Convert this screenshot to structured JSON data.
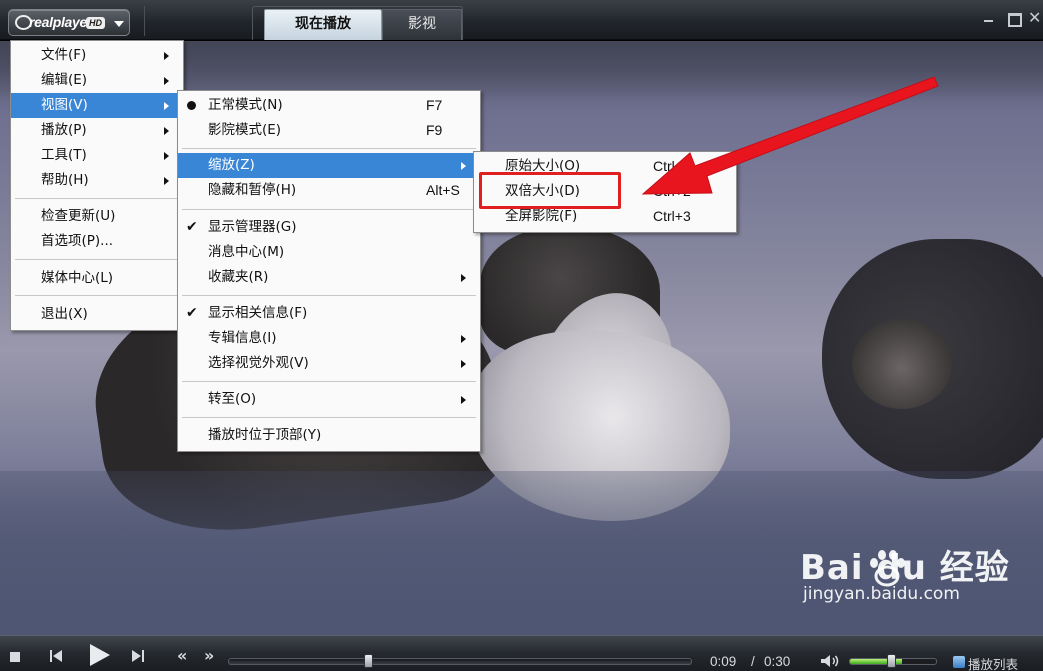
{
  "app": {
    "logo_text": "realplayer",
    "logo_badge": "HD"
  },
  "tabs": [
    {
      "label": "现在播放",
      "active": true
    },
    {
      "label": "影视",
      "active": false
    }
  ],
  "window_controls": {
    "close_glyph": "✕"
  },
  "main_menu": {
    "items": [
      {
        "label": "文件(F)",
        "submenu": true
      },
      {
        "label": "编辑(E)",
        "submenu": true
      },
      {
        "label": "视图(V)",
        "submenu": true,
        "highlighted": true
      },
      {
        "label": "播放(P)",
        "submenu": true
      },
      {
        "label": "工具(T)",
        "submenu": true
      },
      {
        "label": "帮助(H)",
        "submenu": true
      },
      {
        "label": "检查更新(U)"
      },
      {
        "label": "首选项(P)..."
      },
      {
        "label": "媒体中心(L)"
      },
      {
        "label": "退出(X)"
      }
    ]
  },
  "view_menu": {
    "items": [
      {
        "label": "正常模式(N)",
        "shortcut": "F7",
        "mark": "dot"
      },
      {
        "label": "影院模式(E)",
        "shortcut": "F9"
      },
      {
        "label": "缩放(Z)",
        "submenu": true,
        "highlighted": true
      },
      {
        "label": "隐藏和暂停(H)",
        "shortcut": "Alt+S"
      },
      {
        "label": "显示管理器(G)",
        "mark": "check"
      },
      {
        "label": "消息中心(M)"
      },
      {
        "label": "收藏夹(R)",
        "submenu": true
      },
      {
        "label": "显示相关信息(F)",
        "mark": "check"
      },
      {
        "label": "专辑信息(I)",
        "submenu": true
      },
      {
        "label": "选择视觉外观(V)",
        "submenu": true
      },
      {
        "label": "转至(O)",
        "submenu": true
      },
      {
        "label": "播放时位于顶部(Y)"
      }
    ]
  },
  "zoom_menu": {
    "items": [
      {
        "label": "原始大小(O)",
        "shortcut": "Ctrl+1"
      },
      {
        "label": "双倍大小(D)",
        "shortcut": "Ctrl+2"
      },
      {
        "label": "全屏影院(F)",
        "shortcut": "Ctrl+3"
      }
    ]
  },
  "controls": {
    "rewind_glyph": "«",
    "forward_glyph": "»",
    "time_current": "0:09",
    "time_separator": "/",
    "time_total": "0:30",
    "seek_progress": 0.3,
    "volume_level": 0.6,
    "playlist_label": "播放列表"
  },
  "watermark": {
    "logo": "Bai du 经验",
    "url": "jingyan.baidu.com"
  },
  "colors": {
    "menu_highlight": "#3a86d6",
    "annotation_red": "#e02020"
  },
  "icons": [
    "menu-dropdown-icon",
    "minimize-icon",
    "maximize-icon",
    "close-icon",
    "stop-icon",
    "previous-icon",
    "play-icon",
    "next-icon",
    "rewind-icon",
    "fast-forward-icon",
    "volume-icon",
    "playlist-icon",
    "submenu-arrow-icon",
    "radio-dot-icon",
    "checkmark-icon"
  ]
}
